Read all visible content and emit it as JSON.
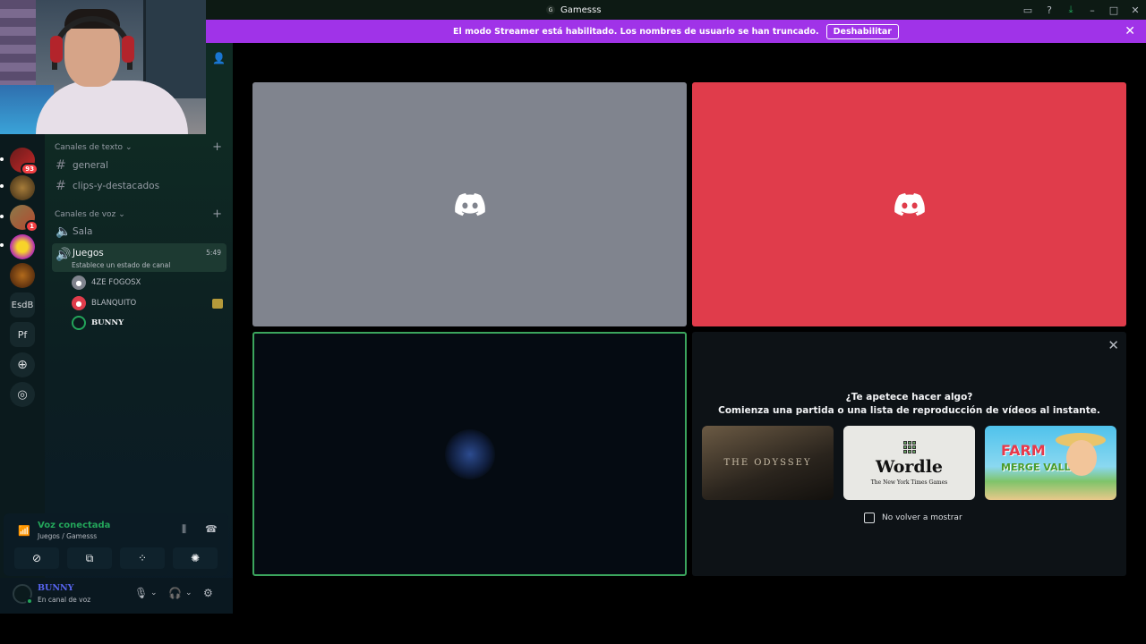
{
  "window": {
    "title": "Gamesss",
    "server_initial": "G"
  },
  "banner": {
    "message": "El modo Streamer está habilitado. Los nombres de usuario se han truncado.",
    "button": "Deshabilitar"
  },
  "rail": {
    "badges": [
      "93",
      "1"
    ],
    "text_servers": [
      "EsdB",
      "Pf"
    ]
  },
  "sidebar": {
    "text_category": "Canales de texto",
    "text_channels": [
      "general",
      "clips-y-destacados"
    ],
    "voice_category": "Canales de voz",
    "voice_channels": [
      {
        "name": "Sala"
      },
      {
        "name": "Juegos",
        "status": "Establece un estado de canal",
        "time": "5:49"
      }
    ],
    "voice_users": [
      "4ZE FOGOSX",
      "BLANQUITO",
      "BUNNY"
    ]
  },
  "voice_panel": {
    "title": "Voz conectada",
    "subtitle": "Juegos / Gamesss"
  },
  "user_panel": {
    "name": "BUNNY",
    "status": "En canal de voz"
  },
  "activity": {
    "title": "¿Te apetece hacer algo?",
    "subtitle": "Comienza una partida o una lista de reproducción de vídeos al instante.",
    "cards": [
      "THE ODYSSEY",
      "Wordle",
      "FARM",
      "MERGE VALLEY"
    ],
    "wordle_byline": "The New York Times Games",
    "checkbox": "No volver a mostrar"
  },
  "colors": {
    "accent": "#a033e8",
    "connected": "#23a55a",
    "red_tile": "#e03c4b",
    "gray_tile": "#80848e"
  }
}
